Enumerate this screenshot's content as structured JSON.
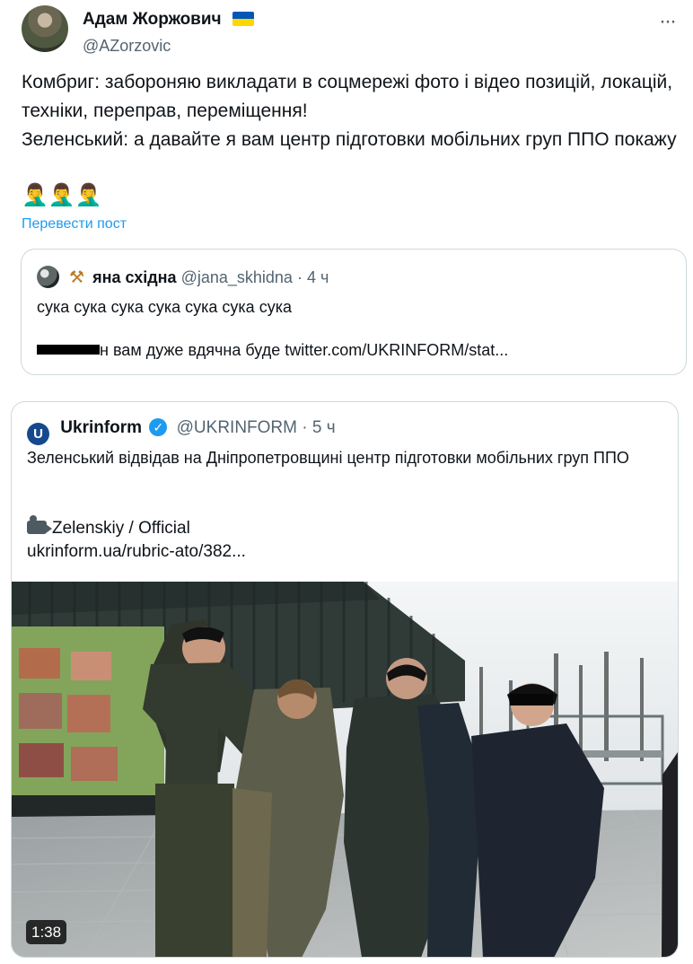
{
  "post": {
    "author_name": "Адам Жоржович",
    "author_handle": "@AZorzovic",
    "text": "Комбриг: забороняю викладати в соцмережі фото і відео позицій, локацій, техніки, переправ, переміщення!\nЗеленський: а давайте я вам центр підготовки мобільних груп ППО покажу",
    "emoji": "🤦‍♂️🤦‍♂️🤦‍♂️",
    "translate_label": "Перевести пост"
  },
  "quoted_post": {
    "name": "яна східна",
    "handle": "@jana_skhidna",
    "separator": "·",
    "time": "4 ч",
    "text": "сука сука сука сука сука сука сука",
    "link_text": "н вам дуже вдячна буде twitter.com/UKRINFORM/stat..."
  },
  "embedded_card": {
    "name": "Ukrinform",
    "logo": "U",
    "handle": "@UKRINFORM",
    "separator": "·",
    "time": "5 ч",
    "text": "Зеленський відвідав на Дніпропетровщині центр підготовки мобільних груп ППО",
    "camera_text": "Zelenskiy / Official",
    "url": "ukrinform.ua/rubric-ato/382...",
    "video_duration": "1:38"
  },
  "colors": {
    "link": "#1d9bf0",
    "muted": "#536471",
    "border": "#cfd9de",
    "flag_blue": "#0057b7",
    "flag_yellow": "#ffd700",
    "verified": "#1d9bf0"
  },
  "icons": {
    "more": "more-horizontal-icon",
    "flag": "ukraine-flag-icon",
    "verified": "verified-badge-icon",
    "camera": "video-camera-icon",
    "tools": "hammer-pick-icon"
  }
}
